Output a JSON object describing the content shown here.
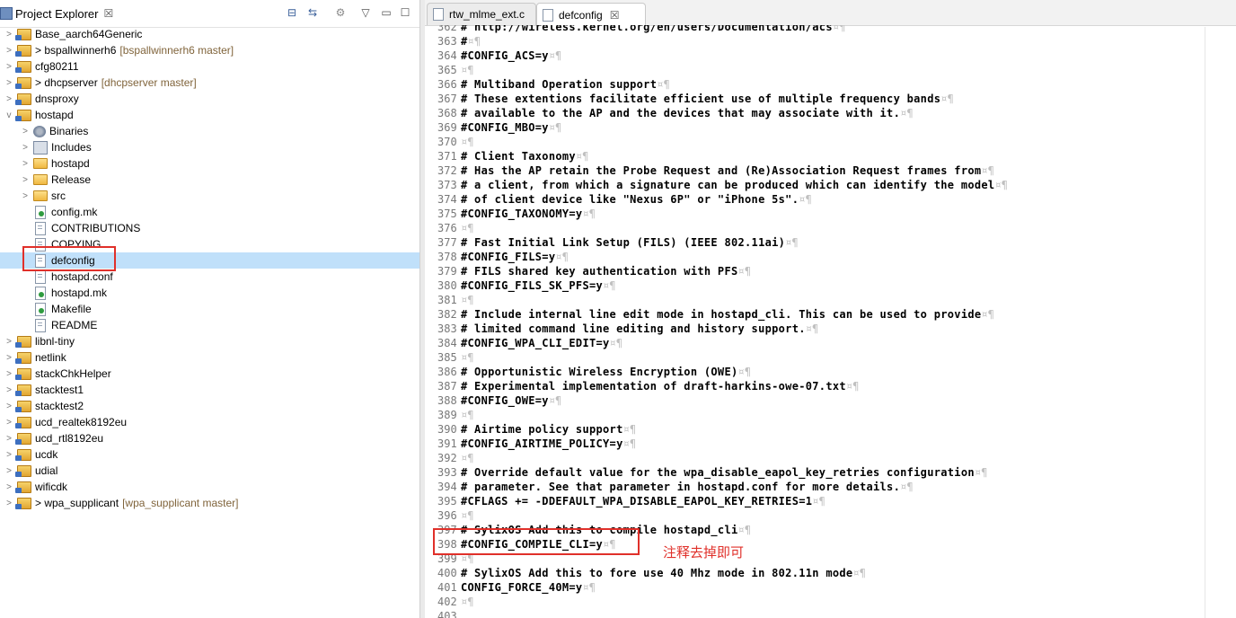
{
  "explorer": {
    "title": "Project Explorer",
    "close": "☒",
    "buttons": {
      "collapse_all": "⊟",
      "link_editor": "⇆",
      "view_menu": "▽",
      "minimize": "▭",
      "maximize": "☐"
    }
  },
  "tree": [
    {
      "level": 0,
      "twisty": ">",
      "icon": "project",
      "label": "Base_aarch64Generic",
      "decor": ""
    },
    {
      "level": 0,
      "twisty": ">",
      "icon": "project",
      "label": "> bspallwinnerh6",
      "decor": "[bspallwinnerh6 master]"
    },
    {
      "level": 0,
      "twisty": ">",
      "icon": "project",
      "label": "cfg80211",
      "decor": ""
    },
    {
      "level": 0,
      "twisty": ">",
      "icon": "project",
      "label": "> dhcpserver",
      "decor": "[dhcpserver master]"
    },
    {
      "level": 0,
      "twisty": ">",
      "icon": "project",
      "label": "dnsproxy",
      "decor": ""
    },
    {
      "level": 0,
      "twisty": "v",
      "icon": "project",
      "label": "hostapd",
      "decor": ""
    },
    {
      "level": 1,
      "twisty": ">",
      "icon": "binaries",
      "label": "Binaries",
      "decor": ""
    },
    {
      "level": 1,
      "twisty": ">",
      "icon": "includes",
      "label": "Includes",
      "decor": ""
    },
    {
      "level": 1,
      "twisty": ">",
      "icon": "folder",
      "label": "hostapd",
      "decor": ""
    },
    {
      "level": 1,
      "twisty": ">",
      "icon": "folder",
      "label": "Release",
      "decor": ""
    },
    {
      "level": 1,
      "twisty": ">",
      "icon": "folder",
      "label": "src",
      "decor": ""
    },
    {
      "level": 1,
      "twisty": "",
      "icon": "mk",
      "label": "config.mk",
      "decor": ""
    },
    {
      "level": 1,
      "twisty": "",
      "icon": "file",
      "label": "CONTRIBUTIONS",
      "decor": ""
    },
    {
      "level": 1,
      "twisty": "",
      "icon": "file",
      "label": "COPYING",
      "decor": ""
    },
    {
      "level": 1,
      "twisty": "",
      "icon": "file",
      "label": "defconfig",
      "decor": "",
      "selected": true
    },
    {
      "level": 1,
      "twisty": "",
      "icon": "file",
      "label": "hostapd.conf",
      "decor": ""
    },
    {
      "level": 1,
      "twisty": "",
      "icon": "mk",
      "label": "hostapd.mk",
      "decor": ""
    },
    {
      "level": 1,
      "twisty": "",
      "icon": "mk",
      "label": "Makefile",
      "decor": ""
    },
    {
      "level": 1,
      "twisty": "",
      "icon": "file",
      "label": "README",
      "decor": ""
    },
    {
      "level": 0,
      "twisty": ">",
      "icon": "project",
      "label": "libnl-tiny",
      "decor": ""
    },
    {
      "level": 0,
      "twisty": ">",
      "icon": "project",
      "label": "netlink",
      "decor": ""
    },
    {
      "level": 0,
      "twisty": ">",
      "icon": "project",
      "label": "stackChkHelper",
      "decor": ""
    },
    {
      "level": 0,
      "twisty": ">",
      "icon": "project",
      "label": "stacktest1",
      "decor": ""
    },
    {
      "level": 0,
      "twisty": ">",
      "icon": "project",
      "label": "stacktest2",
      "decor": ""
    },
    {
      "level": 0,
      "twisty": ">",
      "icon": "project",
      "label": "ucd_realtek8192eu",
      "decor": ""
    },
    {
      "level": 0,
      "twisty": ">",
      "icon": "project",
      "label": "ucd_rtl8192eu",
      "decor": ""
    },
    {
      "level": 0,
      "twisty": ">",
      "icon": "project",
      "label": "ucdk",
      "decor": ""
    },
    {
      "level": 0,
      "twisty": ">",
      "icon": "project",
      "label": "udial",
      "decor": ""
    },
    {
      "level": 0,
      "twisty": ">",
      "icon": "project",
      "label": "wificdk",
      "decor": ""
    },
    {
      "level": 0,
      "twisty": ">",
      "icon": "project",
      "label": "> wpa_supplicant",
      "decor": "[wpa_supplicant master]"
    }
  ],
  "editor": {
    "tabs": [
      {
        "label": "rtw_mlme_ext.c",
        "active": false,
        "close": ""
      },
      {
        "label": "defconfig",
        "active": true,
        "close": "☒"
      }
    ],
    "lines": [
      {
        "n": "362",
        "text": "# http://wireless.kernel.org/en/users/Documentation/acs",
        "end": "¤¶"
      },
      {
        "n": "363",
        "text": "#",
        "end": "¤¶"
      },
      {
        "n": "364",
        "text": "#CONFIG_ACS=y",
        "end": "¤¶"
      },
      {
        "n": "365",
        "text": "",
        "end": "¤¶"
      },
      {
        "n": "366",
        "text": "# Multiband Operation support",
        "end": "¤¶"
      },
      {
        "n": "367",
        "text": "# These extentions facilitate efficient use of multiple frequency bands",
        "end": "¤¶"
      },
      {
        "n": "368",
        "text": "# available to the AP and the devices that may associate with it.",
        "end": "¤¶"
      },
      {
        "n": "369",
        "text": "#CONFIG_MBO=y",
        "end": "¤¶"
      },
      {
        "n": "370",
        "text": "",
        "end": "¤¶"
      },
      {
        "n": "371",
        "text": "# Client Taxonomy",
        "end": "¤¶"
      },
      {
        "n": "372",
        "text": "# Has the AP retain the Probe Request and (Re)Association Request frames from",
        "end": "¤¶"
      },
      {
        "n": "373",
        "text": "# a client, from which a signature can be produced which can identify the model",
        "end": "¤¶"
      },
      {
        "n": "374",
        "text": "# of client device like \"Nexus 6P\" or \"iPhone 5s\".",
        "end": "¤¶"
      },
      {
        "n": "375",
        "text": "#CONFIG_TAXONOMY=y",
        "end": "¤¶"
      },
      {
        "n": "376",
        "text": "",
        "end": "¤¶"
      },
      {
        "n": "377",
        "text": "# Fast Initial Link Setup (FILS) (IEEE 802.11ai)",
        "end": "¤¶"
      },
      {
        "n": "378",
        "text": "#CONFIG_FILS=y",
        "end": "¤¶"
      },
      {
        "n": "379",
        "text": "# FILS shared key authentication with PFS",
        "end": "¤¶"
      },
      {
        "n": "380",
        "text": "#CONFIG_FILS_SK_PFS=y",
        "end": "¤¶"
      },
      {
        "n": "381",
        "text": "",
        "end": "¤¶"
      },
      {
        "n": "382",
        "text": "# Include internal line edit mode in hostapd_cli. This can be used to provide",
        "end": "¤¶"
      },
      {
        "n": "383",
        "text": "# limited command line editing and history support.",
        "end": "¤¶"
      },
      {
        "n": "384",
        "text": "#CONFIG_WPA_CLI_EDIT=y",
        "end": "¤¶"
      },
      {
        "n": "385",
        "text": "",
        "end": "¤¶"
      },
      {
        "n": "386",
        "text": "# Opportunistic Wireless Encryption (OWE)",
        "end": "¤¶"
      },
      {
        "n": "387",
        "text": "# Experimental implementation of draft-harkins-owe-07.txt",
        "end": "¤¶"
      },
      {
        "n": "388",
        "text": "#CONFIG_OWE=y",
        "end": "¤¶"
      },
      {
        "n": "389",
        "text": "",
        "end": "¤¶"
      },
      {
        "n": "390",
        "text": "# Airtime policy support",
        "end": "¤¶"
      },
      {
        "n": "391",
        "text": "#CONFIG_AIRTIME_POLICY=y",
        "end": "¤¶"
      },
      {
        "n": "392",
        "text": "",
        "end": "¤¶"
      },
      {
        "n": "393",
        "text": "# Override default value for the wpa_disable_eapol_key_retries configuration",
        "end": "¤¶"
      },
      {
        "n": "394",
        "text": "# parameter. See that parameter in hostapd.conf for more details.",
        "end": "¤¶"
      },
      {
        "n": "395",
        "text": "#CFLAGS += -DDEFAULT_WPA_DISABLE_EAPOL_KEY_RETRIES=1",
        "end": "¤¶"
      },
      {
        "n": "396",
        "text": "",
        "end": "¤¶"
      },
      {
        "n": "397",
        "text": "# SylixOS Add this to compile hostapd_cli",
        "end": "¤¶"
      },
      {
        "n": "398",
        "text": "#CONFIG_COMPILE_CLI=y",
        "end": "¤¶"
      },
      {
        "n": "399",
        "text": "",
        "end": "¤¶"
      },
      {
        "n": "400",
        "text": "# SylixOS Add this to fore use 40 Mhz mode in 802.11n mode",
        "end": "¤¶"
      },
      {
        "n": "401",
        "text": "CONFIG_FORCE_40M=y",
        "end": "¤¶"
      },
      {
        "n": "402",
        "text": "",
        "end": "¤¶"
      },
      {
        "n": "403",
        "text": "",
        "end": ""
      }
    ]
  },
  "annotation": {
    "note": "注释去掉即可",
    "color": "#e0302a"
  }
}
